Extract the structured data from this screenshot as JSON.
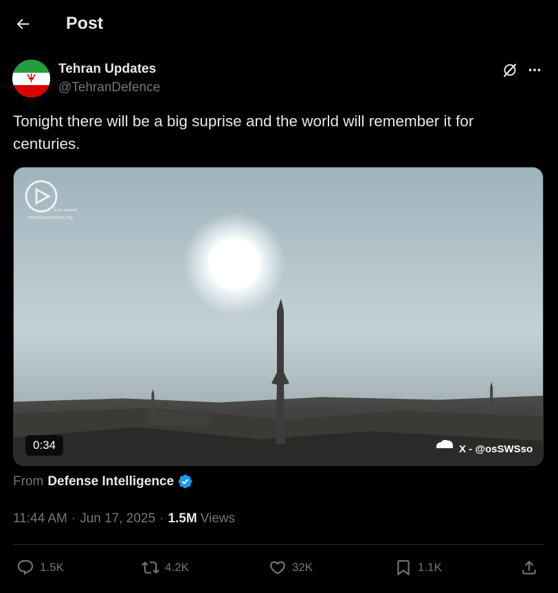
{
  "header": {
    "title": "Post",
    "back_icon": "arrow-left-icon"
  },
  "author": {
    "name": "Tehran Updates",
    "handle": "@TehranDefence",
    "avatar": "iran-flag-avatar"
  },
  "post": {
    "text": "Tonight there will be a big suprise and the world will remember it for centuries."
  },
  "media": {
    "duration": "0:34",
    "watermark": "X - @osSWSso",
    "logo_caption": "www.tasnimnews.org",
    "logo_arabic": "تسنیم مدیا"
  },
  "source": {
    "prefix": "From",
    "name": "Defense Intelligence"
  },
  "meta": {
    "time": "11:44 AM",
    "separator": "·",
    "date": "Jun 17, 2025",
    "views_count": "1.5M",
    "views_label": "Views"
  },
  "actions": {
    "replies": "1.5K",
    "reposts": "4.2K",
    "likes": "32K",
    "bookmarks": "1.1K"
  },
  "colors": {
    "background": "#000000",
    "text": "#e7e9ea",
    "muted": "#71767b",
    "verified": "#1d9bf0",
    "divider": "#2f3336"
  }
}
